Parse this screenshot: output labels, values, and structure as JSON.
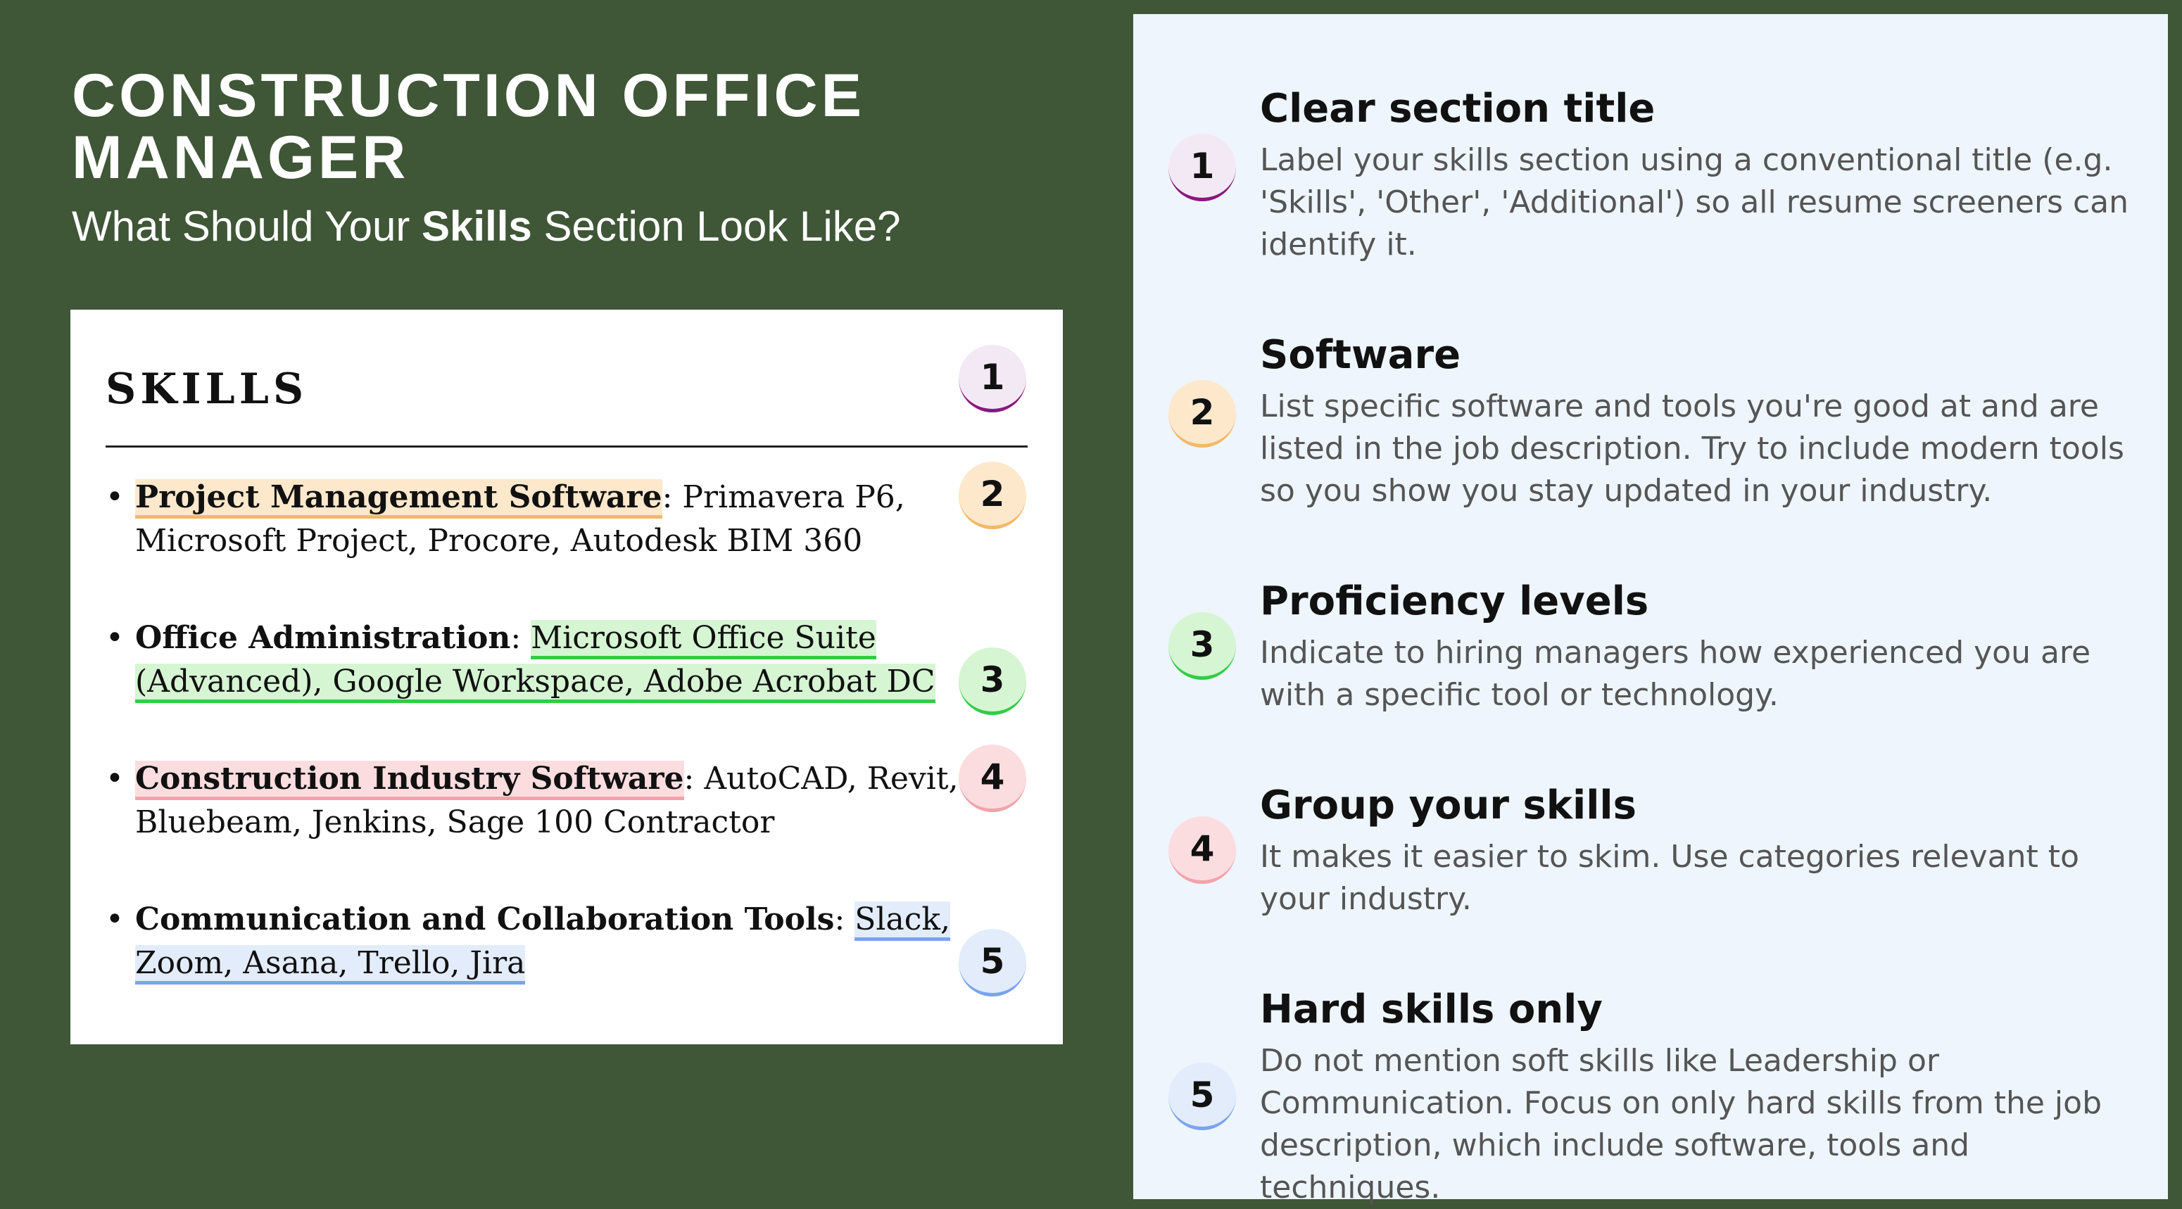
{
  "header": {
    "title": "CONSTRUCTION OFFICE MANAGER",
    "subtitle_pre": "What Should Your ",
    "subtitle_bold": "Skills",
    "subtitle_post": " Section Look Like?"
  },
  "resume_card": {
    "heading": "SKILLS",
    "bullet": "•",
    "items": [
      {
        "category": "Project Management Software",
        "sep": ": ",
        "highlight": "",
        "rest": "Primavera P6, Microsoft Project, Procore, Autodesk BIM 360"
      },
      {
        "category": "Office Administration",
        "sep": ": ",
        "highlight": "Microsoft Office Suite (Advanced), Google Workspace, Adobe Acrobat DC",
        "rest": ""
      },
      {
        "category": "Construction Industry Software",
        "sep": ": ",
        "highlight": "",
        "rest": "AutoCAD, Revit, Bluebeam, Jenkins, Sage 100 Contractor"
      },
      {
        "category": "Communication and Collaboration Tools",
        "sep": ": ",
        "highlight": "Slack, Zoom, Asana, Trello, Jira",
        "rest": ""
      }
    ],
    "badges": [
      "1",
      "2",
      "3",
      "4",
      "5"
    ]
  },
  "tips": [
    {
      "number": "1",
      "title": "Clear section title",
      "body": "Label your skills section using a conventional title (e.g. 'Skills', 'Other', 'Additional') so all resume screeners can identify it."
    },
    {
      "number": "2",
      "title": "Software",
      "body": "List specific software and tools you're good at and are listed in the job description. Try to include modern tools so you show you stay updated in your industry."
    },
    {
      "number": "3",
      "title": "Proficiency levels",
      "body": "Indicate to hiring managers how experienced you are with a specific tool or technology."
    },
    {
      "number": "4",
      "title": "Group your skills",
      "body": "It makes it easier to skim. Use categories relevant to your industry."
    },
    {
      "number": "5",
      "title": "Hard skills only",
      "body": "Do not mention soft skills like Leadership or Communication. Focus on only hard skills from the job description, which include software, tools and techniques."
    }
  ],
  "colors": {
    "background": "#3f5637",
    "panel": "#eef5fd",
    "accent_1": "#8a177d",
    "accent_2": "#f2b86a",
    "accent_3": "#33cc44",
    "accent_4": "#f2a3aa",
    "accent_5": "#7ba3ee"
  }
}
